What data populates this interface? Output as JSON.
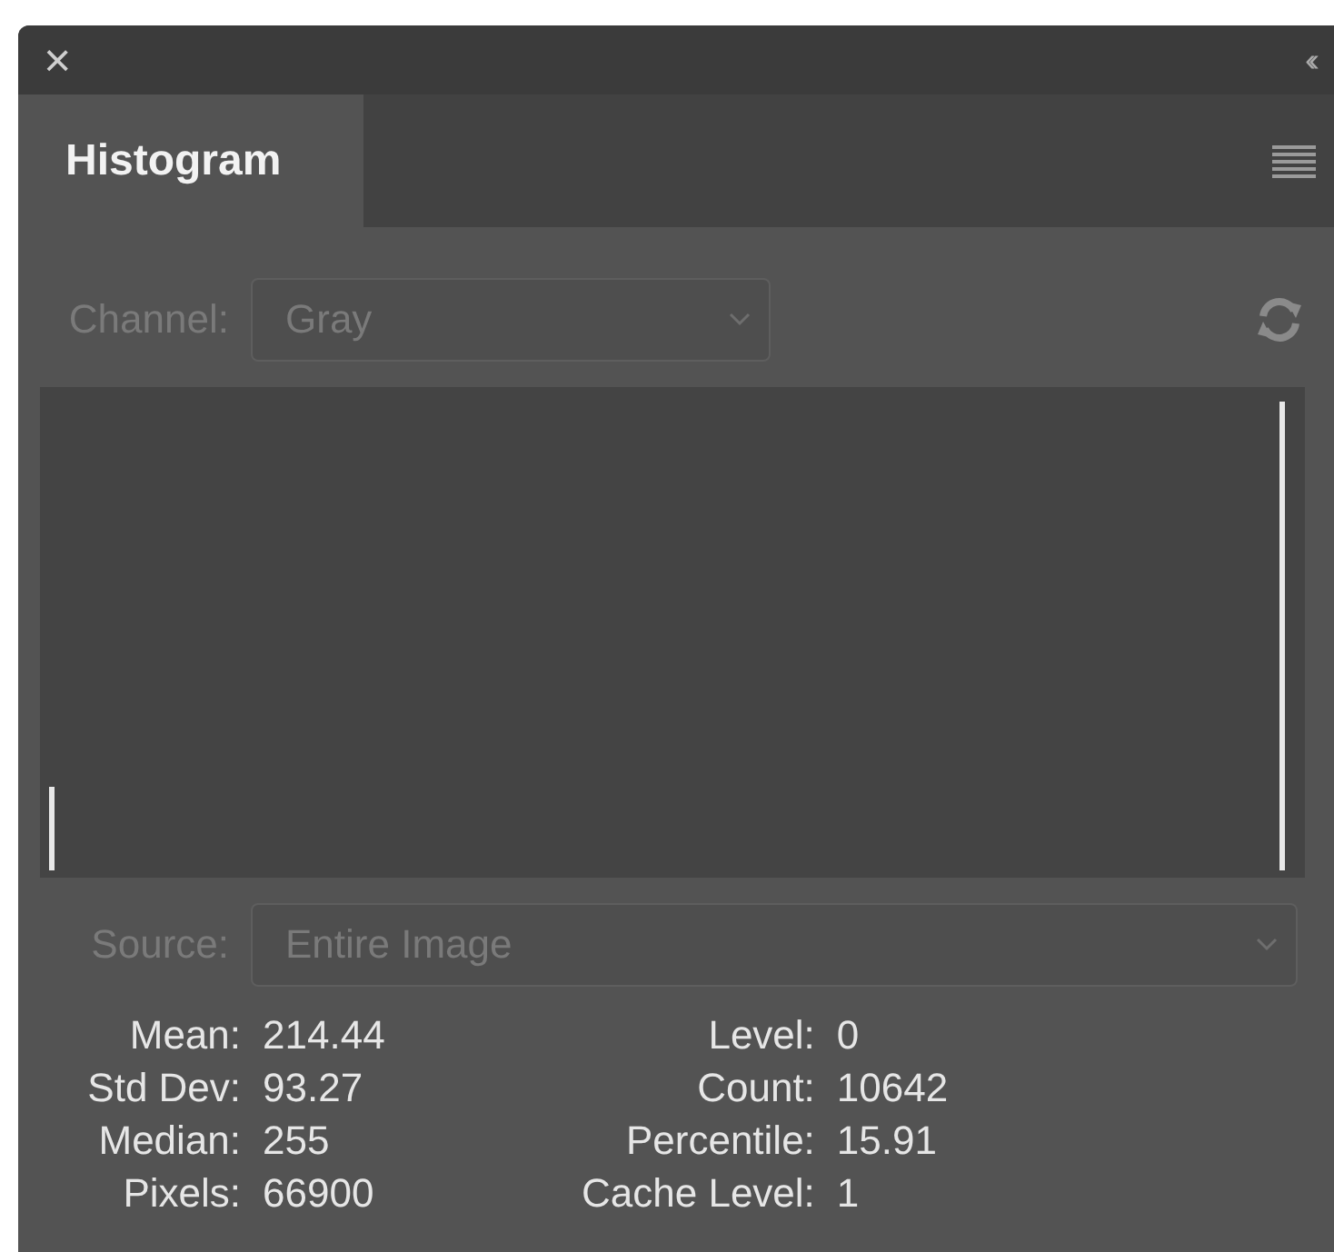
{
  "panel": {
    "close": "×",
    "collapse": "‹‹"
  },
  "tabs": [
    {
      "label": "Histogram",
      "selected": true
    }
  ],
  "channel": {
    "label": "Channel:",
    "value": "Gray",
    "disabled": true
  },
  "source": {
    "label": "Source:",
    "value": "Entire Image",
    "disabled": true
  },
  "stats_left": [
    {
      "label": "Mean:",
      "value": "214.44"
    },
    {
      "label": "Std Dev:",
      "value": "93.27"
    },
    {
      "label": "Median:",
      "value": "255"
    },
    {
      "label": "Pixels:",
      "value": "66900"
    }
  ],
  "stats_right": [
    {
      "label": "Level:",
      "value": "0"
    },
    {
      "label": "Count:",
      "value": "10642"
    },
    {
      "label": "Percentile:",
      "value": "15.91"
    },
    {
      "label": "Cache Level:",
      "value": "1"
    }
  ]
}
